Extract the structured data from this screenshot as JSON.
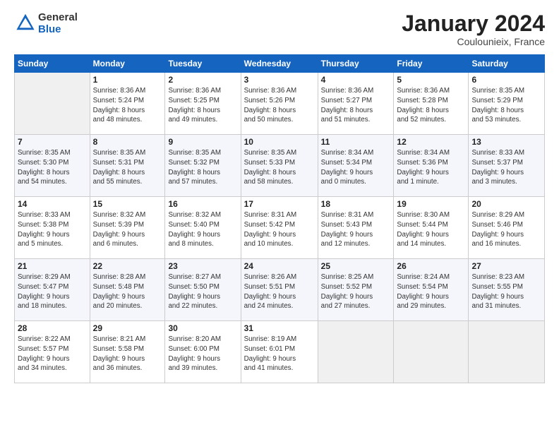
{
  "header": {
    "logo_general": "General",
    "logo_blue": "Blue",
    "title": "January 2024",
    "location": "Coulounieix, France"
  },
  "days_of_week": [
    "Sunday",
    "Monday",
    "Tuesday",
    "Wednesday",
    "Thursday",
    "Friday",
    "Saturday"
  ],
  "weeks": [
    [
      {
        "day": "",
        "info": ""
      },
      {
        "day": "1",
        "info": "Sunrise: 8:36 AM\nSunset: 5:24 PM\nDaylight: 8 hours\nand 48 minutes."
      },
      {
        "day": "2",
        "info": "Sunrise: 8:36 AM\nSunset: 5:25 PM\nDaylight: 8 hours\nand 49 minutes."
      },
      {
        "day": "3",
        "info": "Sunrise: 8:36 AM\nSunset: 5:26 PM\nDaylight: 8 hours\nand 50 minutes."
      },
      {
        "day": "4",
        "info": "Sunrise: 8:36 AM\nSunset: 5:27 PM\nDaylight: 8 hours\nand 51 minutes."
      },
      {
        "day": "5",
        "info": "Sunrise: 8:36 AM\nSunset: 5:28 PM\nDaylight: 8 hours\nand 52 minutes."
      },
      {
        "day": "6",
        "info": "Sunrise: 8:35 AM\nSunset: 5:29 PM\nDaylight: 8 hours\nand 53 minutes."
      }
    ],
    [
      {
        "day": "7",
        "info": "Sunrise: 8:35 AM\nSunset: 5:30 PM\nDaylight: 8 hours\nand 54 minutes."
      },
      {
        "day": "8",
        "info": "Sunrise: 8:35 AM\nSunset: 5:31 PM\nDaylight: 8 hours\nand 55 minutes."
      },
      {
        "day": "9",
        "info": "Sunrise: 8:35 AM\nSunset: 5:32 PM\nDaylight: 8 hours\nand 57 minutes."
      },
      {
        "day": "10",
        "info": "Sunrise: 8:35 AM\nSunset: 5:33 PM\nDaylight: 8 hours\nand 58 minutes."
      },
      {
        "day": "11",
        "info": "Sunrise: 8:34 AM\nSunset: 5:34 PM\nDaylight: 9 hours\nand 0 minutes."
      },
      {
        "day": "12",
        "info": "Sunrise: 8:34 AM\nSunset: 5:36 PM\nDaylight: 9 hours\nand 1 minute."
      },
      {
        "day": "13",
        "info": "Sunrise: 8:33 AM\nSunset: 5:37 PM\nDaylight: 9 hours\nand 3 minutes."
      }
    ],
    [
      {
        "day": "14",
        "info": "Sunrise: 8:33 AM\nSunset: 5:38 PM\nDaylight: 9 hours\nand 5 minutes."
      },
      {
        "day": "15",
        "info": "Sunrise: 8:32 AM\nSunset: 5:39 PM\nDaylight: 9 hours\nand 6 minutes."
      },
      {
        "day": "16",
        "info": "Sunrise: 8:32 AM\nSunset: 5:40 PM\nDaylight: 9 hours\nand 8 minutes."
      },
      {
        "day": "17",
        "info": "Sunrise: 8:31 AM\nSunset: 5:42 PM\nDaylight: 9 hours\nand 10 minutes."
      },
      {
        "day": "18",
        "info": "Sunrise: 8:31 AM\nSunset: 5:43 PM\nDaylight: 9 hours\nand 12 minutes."
      },
      {
        "day": "19",
        "info": "Sunrise: 8:30 AM\nSunset: 5:44 PM\nDaylight: 9 hours\nand 14 minutes."
      },
      {
        "day": "20",
        "info": "Sunrise: 8:29 AM\nSunset: 5:46 PM\nDaylight: 9 hours\nand 16 minutes."
      }
    ],
    [
      {
        "day": "21",
        "info": "Sunrise: 8:29 AM\nSunset: 5:47 PM\nDaylight: 9 hours\nand 18 minutes."
      },
      {
        "day": "22",
        "info": "Sunrise: 8:28 AM\nSunset: 5:48 PM\nDaylight: 9 hours\nand 20 minutes."
      },
      {
        "day": "23",
        "info": "Sunrise: 8:27 AM\nSunset: 5:50 PM\nDaylight: 9 hours\nand 22 minutes."
      },
      {
        "day": "24",
        "info": "Sunrise: 8:26 AM\nSunset: 5:51 PM\nDaylight: 9 hours\nand 24 minutes."
      },
      {
        "day": "25",
        "info": "Sunrise: 8:25 AM\nSunset: 5:52 PM\nDaylight: 9 hours\nand 27 minutes."
      },
      {
        "day": "26",
        "info": "Sunrise: 8:24 AM\nSunset: 5:54 PM\nDaylight: 9 hours\nand 29 minutes."
      },
      {
        "day": "27",
        "info": "Sunrise: 8:23 AM\nSunset: 5:55 PM\nDaylight: 9 hours\nand 31 minutes."
      }
    ],
    [
      {
        "day": "28",
        "info": "Sunrise: 8:22 AM\nSunset: 5:57 PM\nDaylight: 9 hours\nand 34 minutes."
      },
      {
        "day": "29",
        "info": "Sunrise: 8:21 AM\nSunset: 5:58 PM\nDaylight: 9 hours\nand 36 minutes."
      },
      {
        "day": "30",
        "info": "Sunrise: 8:20 AM\nSunset: 6:00 PM\nDaylight: 9 hours\nand 39 minutes."
      },
      {
        "day": "31",
        "info": "Sunrise: 8:19 AM\nSunset: 6:01 PM\nDaylight: 9 hours\nand 41 minutes."
      },
      {
        "day": "",
        "info": ""
      },
      {
        "day": "",
        "info": ""
      },
      {
        "day": "",
        "info": ""
      }
    ]
  ]
}
